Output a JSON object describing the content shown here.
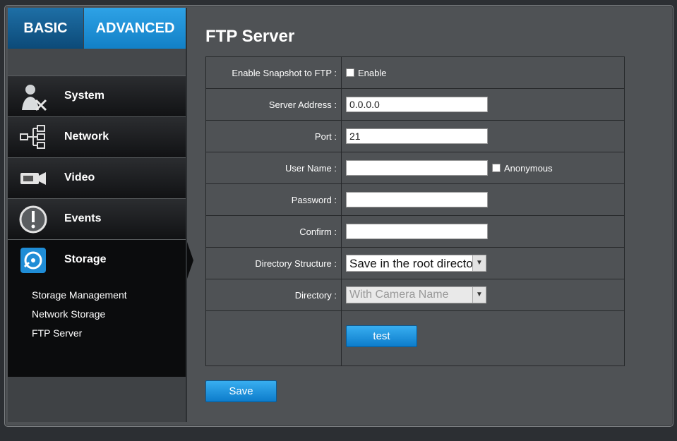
{
  "tabs": {
    "basic": "BASIC",
    "advanced": "ADVANCED"
  },
  "sidebar": {
    "items": [
      {
        "label": "System",
        "icon": "system-icon"
      },
      {
        "label": "Network",
        "icon": "network-icon"
      },
      {
        "label": "Video",
        "icon": "video-camera-icon"
      },
      {
        "label": "Events",
        "icon": "alert-icon"
      },
      {
        "label": "Storage",
        "icon": "storage-icon"
      }
    ],
    "submenu": [
      "Storage Management",
      "Network Storage",
      "FTP Server"
    ]
  },
  "page": {
    "title": "FTP Server"
  },
  "form": {
    "enable_label": "Enable Snapshot to FTP :",
    "enable_checkbox": "Enable",
    "server_label": "Server Address :",
    "server_value": "0.0.0.0",
    "port_label": "Port :",
    "port_value": "21",
    "user_label": "User Name :",
    "user_value": "",
    "anonymous": "Anonymous",
    "password_label": "Password :",
    "confirm_label": "Confirm :",
    "dir_struct_label": "Directory Structure :",
    "dir_struct_value": "Save in the root directory",
    "directory_label": "Directory :",
    "directory_value": "With Camera Name",
    "test_button": "test"
  },
  "save_button": "Save",
  "colors": {
    "accent": "#1a8ad6",
    "panel": "#4f5255"
  }
}
